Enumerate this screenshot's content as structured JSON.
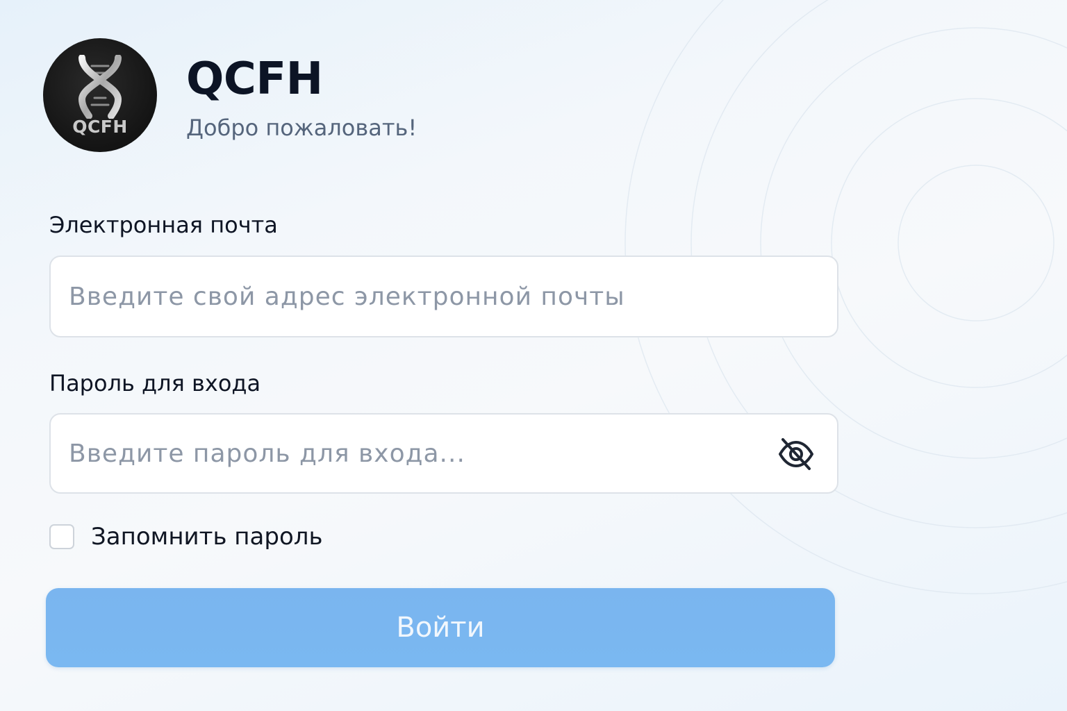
{
  "brand": {
    "logo_text": "QCFH",
    "title": "QCFH",
    "subtitle": "Добро пожаловать!"
  },
  "form": {
    "email": {
      "label": "Электронная почта",
      "placeholder": "Введите свой адрес электронной почты",
      "value": ""
    },
    "password": {
      "label": "Пароль для входа",
      "placeholder": "Введите пароль для входа...",
      "value": "",
      "visibility_icon": "eye-off-icon"
    },
    "remember": {
      "label": "Запомнить пароль",
      "checked": false
    },
    "submit_label": "Войти"
  },
  "colors": {
    "button": "#7ab6f0",
    "title": "#0c1425",
    "subtitle": "#55657c",
    "placeholder": "#8d97a6",
    "logo_bg": "#141414"
  }
}
